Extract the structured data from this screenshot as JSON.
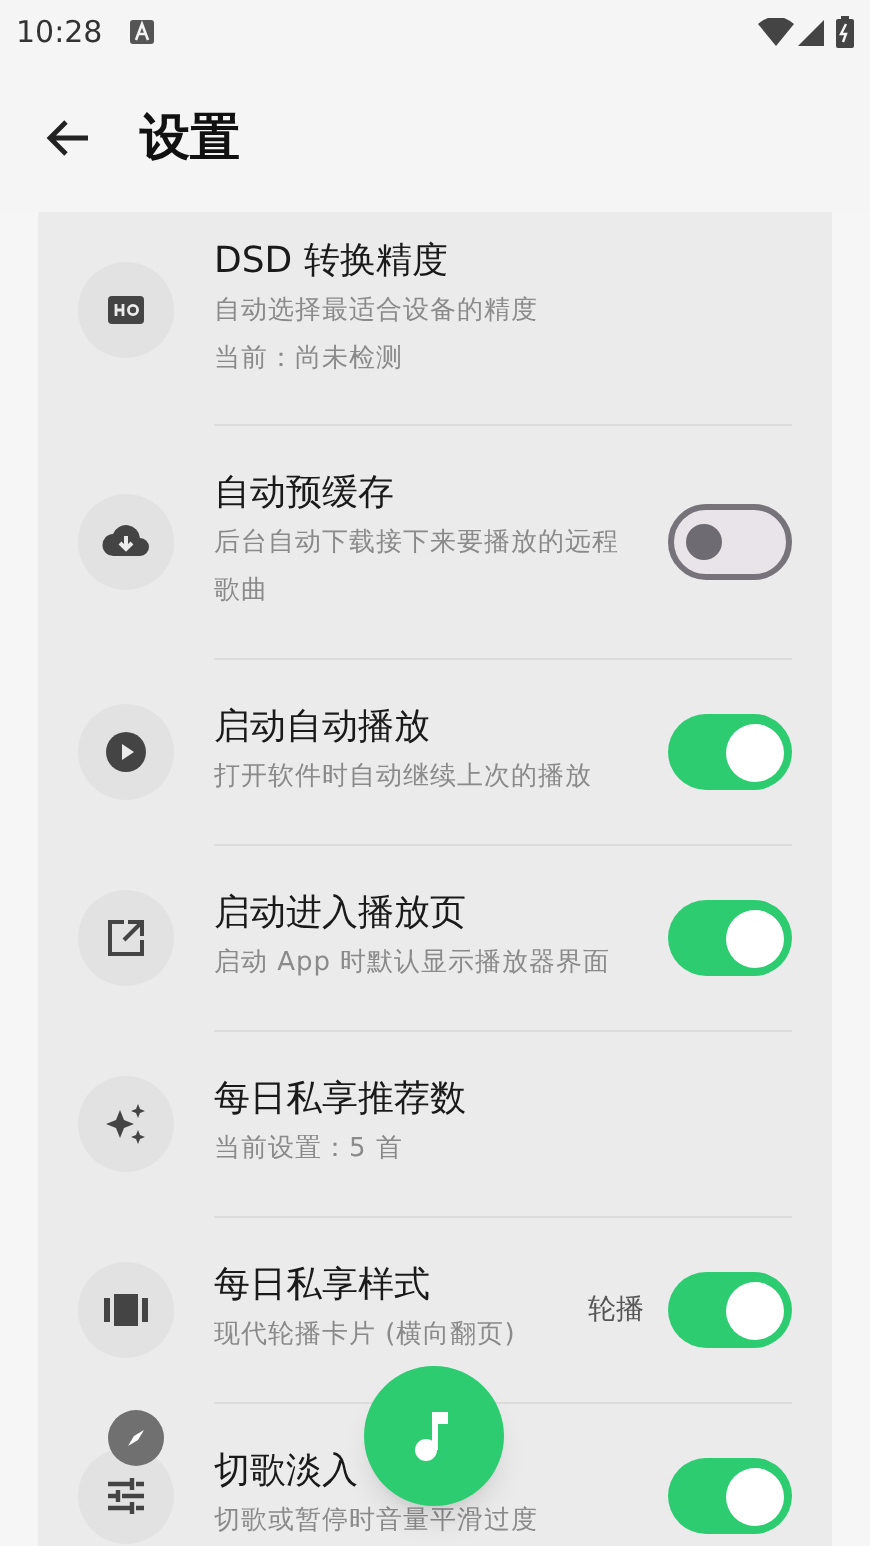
{
  "status_bar": {
    "time": "10:28"
  },
  "header": {
    "title": "设置"
  },
  "settings": [
    {
      "kind": "info",
      "title": "DSD 转换精度",
      "description": "自动选择最适合设备的精度",
      "detail": "当前：尚未检测"
    },
    {
      "kind": "switch",
      "title": "自动预缓存",
      "description": "后台自动下载接下来要播放的远程歌曲",
      "on": false
    },
    {
      "kind": "switch",
      "title": "启动自动播放",
      "description": "打开软件时自动继续上次的播放",
      "on": true
    },
    {
      "kind": "switch",
      "title": "启动进入播放页",
      "description": "启动 App 时默认显示播放器界面",
      "on": true
    },
    {
      "kind": "info",
      "title": "每日私享推荐数",
      "description": "当前设置：5 首"
    },
    {
      "kind": "switch",
      "title": "每日私享样式",
      "description": "现代轮播卡片 (横向翻页)",
      "value": "轮播",
      "on": true
    },
    {
      "kind": "switch",
      "title": "切歌淡入",
      "description": "切歌或暂停时音量平滑过度",
      "on": true
    }
  ]
}
